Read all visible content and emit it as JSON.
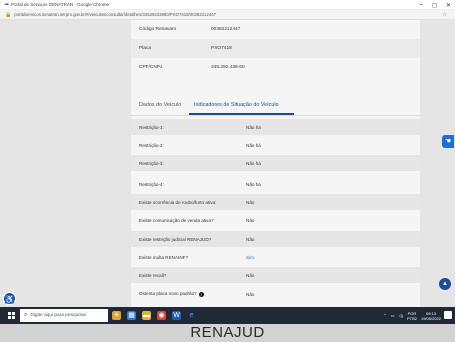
{
  "browser": {
    "window_title": "Portal de Serviços DENATRAN - Google Chrome",
    "url": "portalservicos.senatran.serpro.gov.br/#/veiculos/consultar/detalhes/34529243860/PXO7418/00382212447",
    "win_minimize": "–",
    "win_restore": "◻",
    "win_close": "✕"
  },
  "vehicle": {
    "rows": [
      {
        "label": "Código Renavam",
        "value": "00382212447"
      },
      {
        "label": "Placa",
        "value": "PXO7418"
      },
      {
        "label": "CPF/CNPJ",
        "value": "345.292.438-60"
      }
    ]
  },
  "tabs": [
    {
      "label": "Dados do Veículo",
      "active": false
    },
    {
      "label": "Indicadores de Situação do Veículo",
      "active": true
    }
  ],
  "indicators": [
    {
      "label": "Restrição-1:",
      "value": "Não há"
    },
    {
      "label": "Restrição-2:",
      "value": "Não há"
    },
    {
      "label": "Restrição-3:",
      "value": "Não há"
    },
    {
      "label": "Restrição-4:",
      "value": "Não há"
    },
    {
      "label": "Existe ocorrência de roubo/furto ativa:",
      "value": "Não"
    },
    {
      "label": "Existe comunicação de venda ativa?",
      "value": "Não"
    },
    {
      "label": "Existe restrição judicial RENAJUD?",
      "value": "Não"
    },
    {
      "label": "Existe multa RENAINF?",
      "value": "Sim"
    },
    {
      "label": "Existe recall?",
      "value": "Não"
    },
    {
      "label": "Ostenta placa novo padrão?",
      "value": "Não"
    }
  ],
  "taskbar": {
    "search_placeholder": "Digite aqui para pesquisar",
    "lang_top": "POR",
    "lang_bottom": "PTB2",
    "time": "09:13",
    "date": "19/05/2022"
  },
  "caption": "RENAJUD",
  "colors": {
    "accent": "#1e4d8a",
    "link": "#2d6ac9",
    "taskbar": "#1f2a36"
  }
}
